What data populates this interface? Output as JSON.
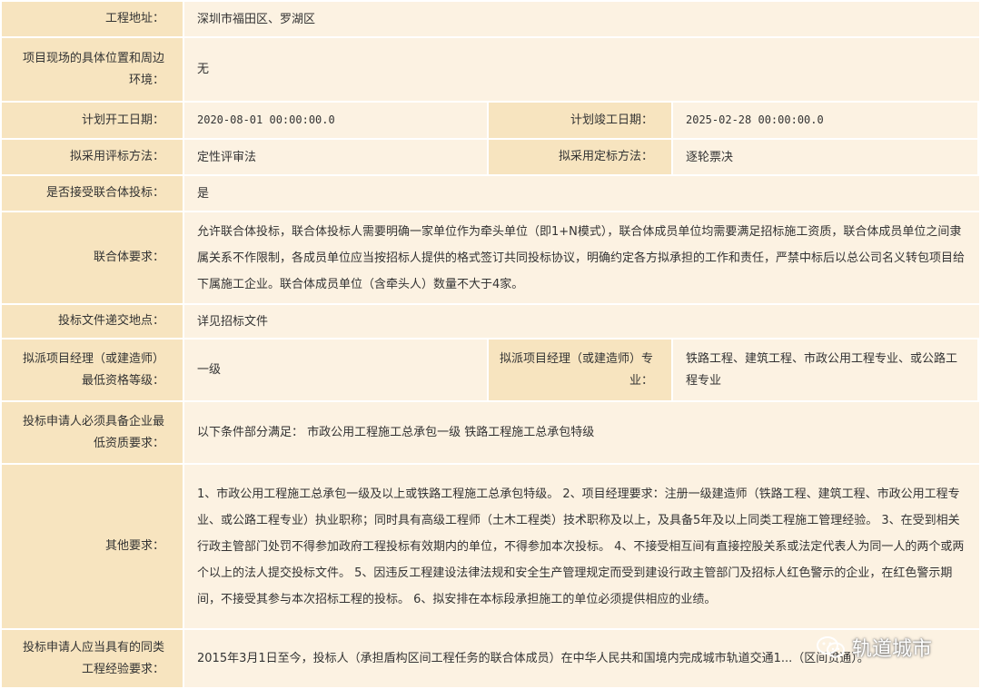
{
  "rows": {
    "address": {
      "label": "工程地址：",
      "value": "深圳市福田区、罗湖区"
    },
    "location": {
      "label": "项目现场的具体位置和周边环境：",
      "value": "无"
    },
    "start_date": {
      "label": "计划开工日期：",
      "value": "2020-08-01 00:00:00.0"
    },
    "end_date": {
      "label": "计划竣工日期：",
      "value": "2025-02-28 00:00:00.0"
    },
    "bid_eval": {
      "label": "拟采用评标方法：",
      "value": "定性评审法"
    },
    "award_method": {
      "label": "拟采用定标方法：",
      "value": "逐轮票决"
    },
    "consortium": {
      "label": "是否接受联合体投标：",
      "value": "是"
    },
    "consortium_req": {
      "label": "联合体要求：",
      "value": "允许联合体投标，联合体投标人需要明确一家单位作为牵头单位（即1+N模式），联合体成员单位均需要满足招标施工资质，联合体成员单位之间隶属关系不作限制，各成员单位应当按招标人提供的格式签订共同投标协议，明确约定各方拟承担的工作和责任，严禁中标后以总公司名义转包项目给下属施工企业。联合体成员单位（含牵头人）数量不大于4家。"
    },
    "submission_place": {
      "label": "投标文件递交地点：",
      "value": "详见招标文件"
    },
    "pm_level": {
      "label": "拟派项目经理（或建造师）最低资格等级：",
      "value": "一级"
    },
    "pm_major": {
      "label": "拟派项目经理（或建造师）专业：",
      "value": "铁路工程、建筑工程、市政公用工程专业、或公路工程专业"
    },
    "qualification": {
      "label": "投标申请人必须具备企业最低资质要求：",
      "value": "以下条件部分满足： 市政公用工程施工总承包一级 铁路工程施工总承包特级"
    },
    "other_req": {
      "label": "其他要求：",
      "value": "1、市政公用工程施工总承包一级及以上或铁路工程施工总承包特级。 2、项目经理要求：注册一级建造师（铁路工程、建筑工程、市政公用工程专业、或公路工程专业）执业职称；同时具有高级工程师（土木工程类）技术职称及以上，及具备5年及以上同类工程施工管理经验。 3、在受到相关行政主管部门处罚不得参加政府工程投标有效期内的单位，不得参加本次投标。 4、不接受相互间有直接控股关系或法定代表人为同一人的两个或两个以上的法人提交投标文件。 5、因违反工程建设法律法规和安全生产管理规定而受到建设行政主管部门及招标人红色警示的企业，在红色警示期间，不接受其参与本次招标工程的投标。 6、拟安排在本标段承担施工的单位必须提供相应的业绩。"
    },
    "experience": {
      "label": "投标申请人应当具有的同类工程经验要求：",
      "value": "2015年3月1日至今，投标人（承担盾构区间工程任务的联合体成员）在中华人民共和国境内完成城市轨道交通1...（区间贯通）。"
    }
  },
  "watermark": {
    "text": "轨道城市",
    "icon": "wechat-icon"
  }
}
